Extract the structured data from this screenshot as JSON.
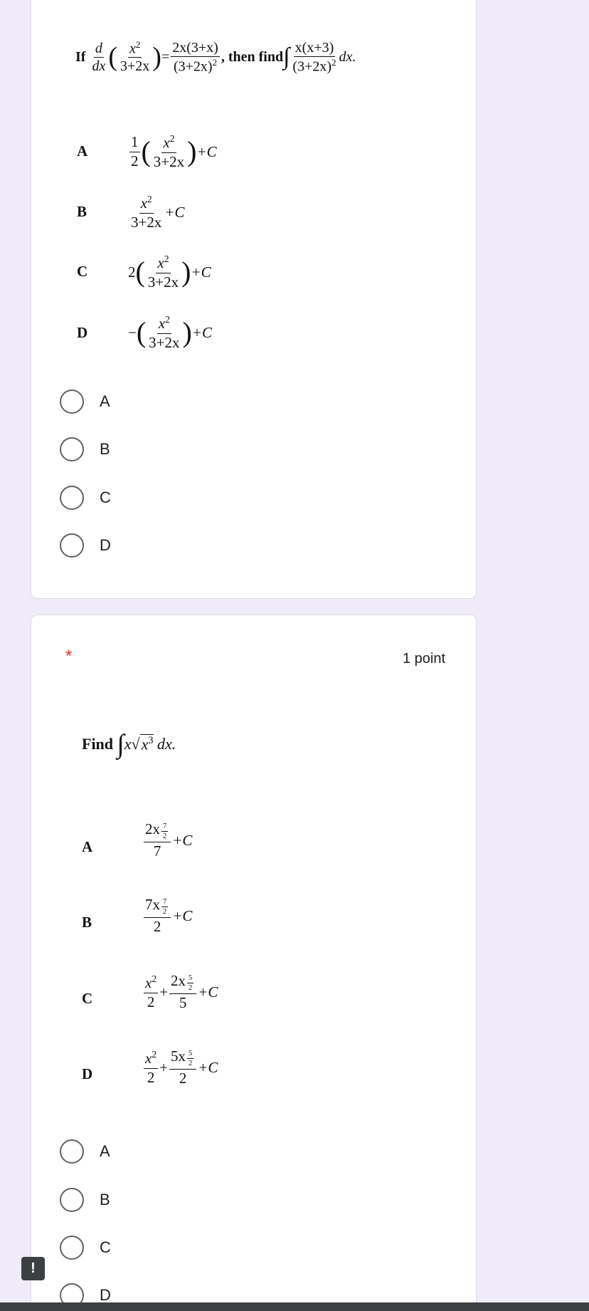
{
  "question1": {
    "text": {
      "if": "If",
      "d": "d",
      "dx": "dx",
      "x2": "x",
      "denom": "3+2x",
      "rhs_num": "2x(3+x)",
      "rhs_den": "(3+2x)",
      "then_find": ", then find",
      "int_num": "x(x+3)",
      "int_den": "(3+2x)",
      "dx_end": "dx."
    },
    "options": [
      {
        "letter": "A",
        "coef": "1",
        "coef_den": "2",
        "frac_num": "x",
        "frac_den": "3+2x",
        "tail": "+C"
      },
      {
        "letter": "B",
        "frac_num": "x",
        "frac_den": "3+2x",
        "tail": "+C"
      },
      {
        "letter": "C",
        "coef": "2",
        "frac_num": "x",
        "frac_den": "3+2x",
        "tail": "+C"
      },
      {
        "letter": "D",
        "coef": "−",
        "frac_num": "x",
        "frac_den": "3+2x",
        "tail": "+C"
      }
    ],
    "choices": [
      "A",
      "B",
      "C",
      "D"
    ]
  },
  "question2": {
    "required_mark": "*",
    "points": "1 point",
    "text": {
      "find": "Find",
      "x": "x",
      "x3": "x",
      "dx": "dx."
    },
    "options": [
      {
        "letter": "A",
        "num": "2x",
        "exp_num": "7",
        "exp_den": "2",
        "den": "7",
        "tail": "+C"
      },
      {
        "letter": "B",
        "num": "7x",
        "exp_num": "7",
        "exp_den": "2",
        "den": "2",
        "tail": "+C"
      },
      {
        "letter": "C",
        "p1_num": "x",
        "p1_den": "2",
        "p2_num": "2x",
        "exp_num": "5",
        "exp_den": "2",
        "p2_den": "5",
        "tail": "+C"
      },
      {
        "letter": "D",
        "p1_num": "x",
        "p1_den": "2",
        "p2_num": "5x",
        "exp_num": "5",
        "exp_den": "2",
        "p2_den": "2",
        "tail": "+C"
      }
    ],
    "choices": [
      "A",
      "B",
      "C",
      "D"
    ]
  },
  "report_button": "!"
}
